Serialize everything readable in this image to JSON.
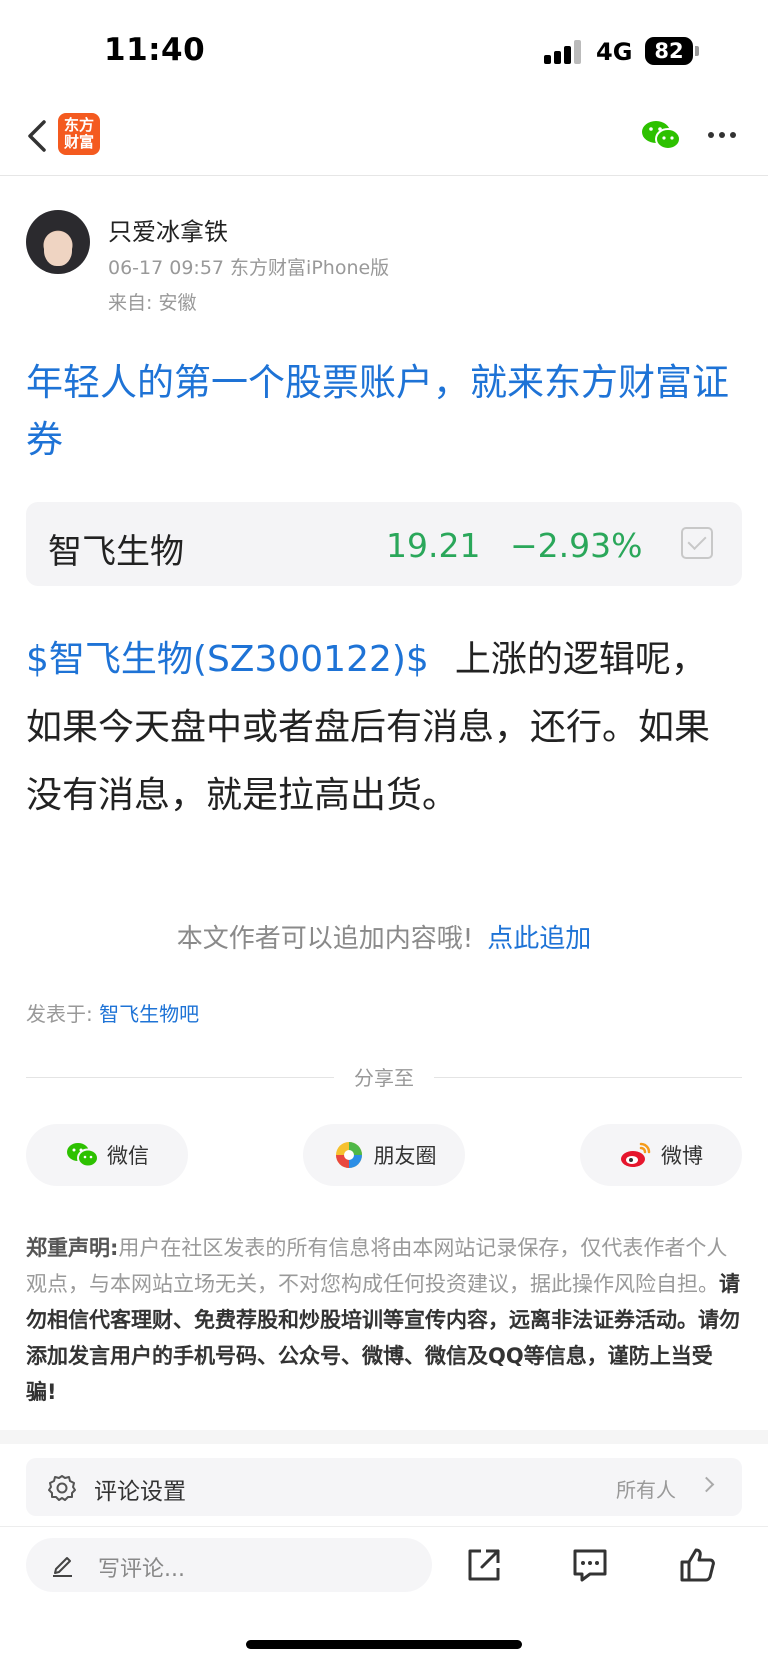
{
  "status_bar": {
    "time": "11:40",
    "network": "4G",
    "battery": "82"
  },
  "nav": {
    "logo_text": "东方\n财富",
    "icons": [
      "back-icon",
      "wechat-icon",
      "more-icon"
    ]
  },
  "author": {
    "name": "只爱冰拿铁",
    "meta": "06-17 09:57 东方财富iPhone版",
    "from_label": "来自: 安徽"
  },
  "post": {
    "title": "年轻人的第一个股票账户，就来东方财富证券",
    "stock_card": {
      "name": "智飞生物",
      "price": "19.21",
      "change": "−2.93%",
      "price_color": "#2aa75a"
    },
    "stock_link": "$智飞生物(SZ300122)$",
    "body": "上涨的逻辑呢，如果今天盘中或者盘后有消息，还行。如果没有消息，就是拉高出货。",
    "append_text": "本文作者可以追加内容哦!",
    "append_link": "点此追加",
    "published_label": "发表于: ",
    "published_bar": "智飞生物吧"
  },
  "share": {
    "title": "分享至",
    "buttons": [
      {
        "label": "微信",
        "icon": "wechat-icon"
      },
      {
        "label": "朋友圈",
        "icon": "moments-icon"
      },
      {
        "label": "微博",
        "icon": "weibo-icon"
      }
    ]
  },
  "disclaimer": {
    "heading": "郑重声明:",
    "text": "用户在社区发表的所有信息将由本网站记录保存，仅代表作者个人观点，与本网站立场无关，不对您构成任何投资建议，据此操作风险自担。",
    "strong": "请勿相信代客理财、免费荐股和炒股培训等宣传内容，远离非法证券活动。请勿添加发言用户的手机号码、公众号、微博、微信及QQ等信息，谨防上当受骗!"
  },
  "comment_settings": {
    "label": "评论设置",
    "value": "所有人"
  },
  "toolbar": {
    "placeholder": "写评论...",
    "icons": [
      "share-out-icon",
      "comment-icon",
      "like-icon"
    ]
  },
  "colors": {
    "link": "#1e73d6",
    "stock_down": "#2aa75a",
    "logo": "#f45a1f"
  }
}
